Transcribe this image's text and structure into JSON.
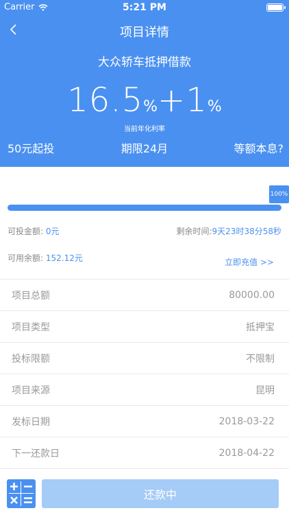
{
  "status_bar": {
    "carrier": "Carrier",
    "time": "5:21 PM"
  },
  "header": {
    "title": "项目详情"
  },
  "project": {
    "name": "大众轿车抵押借款",
    "rate_base": "16.5",
    "rate_extra": "+1",
    "percent_sign": "%",
    "rate_label": "当前年化利率",
    "min_invest": "50元起投",
    "term": "期限24月",
    "repay_method": "等额本息?"
  },
  "progress": {
    "percent": 100,
    "label": "100%"
  },
  "investment": {
    "available_label": "可投金额:",
    "available_value": "0元",
    "remaining_label": "剩余时间:",
    "remaining_value": "9天23时38分58秒",
    "balance_label": "可用余额:",
    "balance_value": "152.12元",
    "recharge_label": "立即充值 >>"
  },
  "details": [
    {
      "label": "项目总额",
      "value": "80000.00"
    },
    {
      "label": "项目类型",
      "value": "抵押宝"
    },
    {
      "label": "投标限额",
      "value": "不限制"
    },
    {
      "label": "项目来源",
      "value": "昆明"
    },
    {
      "label": "发标日期",
      "value": "2018-03-22"
    },
    {
      "label": "下一还款日",
      "value": "2018-04-22"
    }
  ],
  "footer": {
    "repay_button": "还款中"
  },
  "colors": {
    "primary": "#4a90f0",
    "button_disabled": "#a5cbf7"
  }
}
